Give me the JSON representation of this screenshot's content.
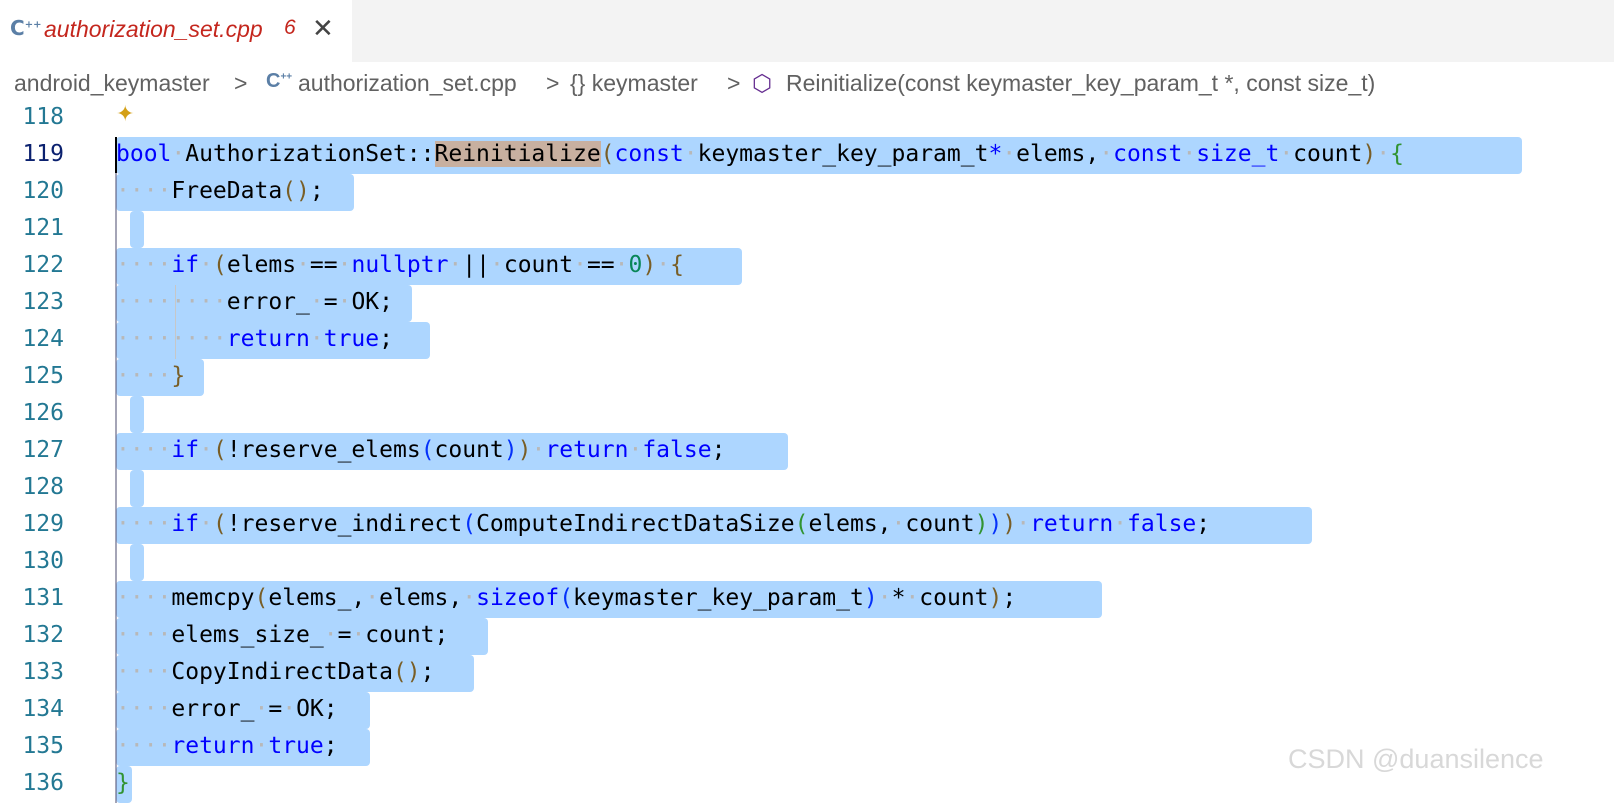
{
  "tab": {
    "icon": "cpp-file-icon",
    "title": "authorization_set.cpp",
    "problems_count": "6",
    "close_icon": "close-icon"
  },
  "breadcrumb": {
    "folder": "android_keymaster",
    "file": "authorization_set.cpp",
    "namespace": "{} keymaster",
    "symbol": "Reinitialize(const keymaster_key_param_t *, const size_t)",
    "separator": ">"
  },
  "editor": {
    "lines": [
      {
        "no": "118"
      },
      {
        "no": "119"
      },
      {
        "no": "120"
      },
      {
        "no": "121"
      },
      {
        "no": "122"
      },
      {
        "no": "123"
      },
      {
        "no": "124"
      },
      {
        "no": "125"
      },
      {
        "no": "126"
      },
      {
        "no": "127"
      },
      {
        "no": "128"
      },
      {
        "no": "129"
      },
      {
        "no": "130"
      },
      {
        "no": "131"
      },
      {
        "no": "132"
      },
      {
        "no": "133"
      },
      {
        "no": "134"
      },
      {
        "no": "135"
      },
      {
        "no": "136"
      }
    ]
  },
  "watermark": "CSDN @duansilence",
  "colors": {
    "selection": "#add6ff",
    "keyword": "#0000ff",
    "line_number": "#237893",
    "tab_title": "#c4261d"
  }
}
